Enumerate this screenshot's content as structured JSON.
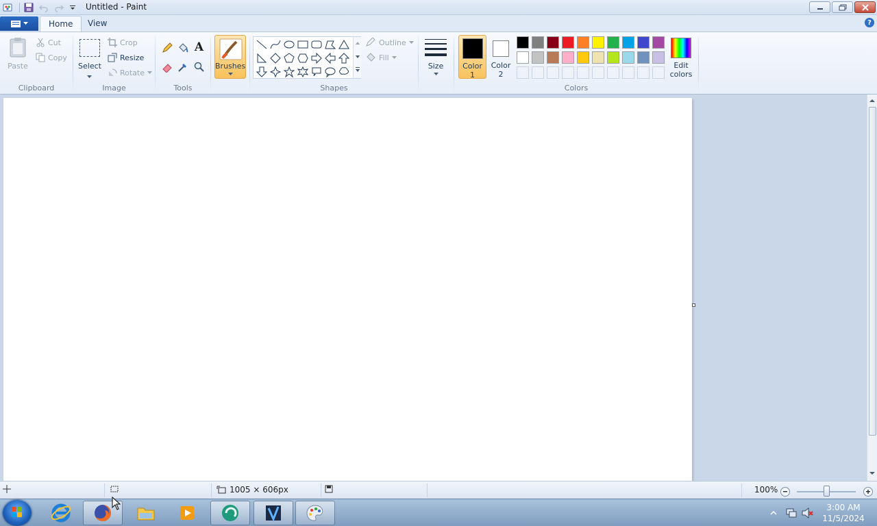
{
  "window": {
    "title": "Untitled - Paint"
  },
  "tabs": [
    {
      "label": "Home"
    },
    {
      "label": "View"
    }
  ],
  "clipboard": {
    "paste": "Paste",
    "cut": "Cut",
    "copy": "Copy",
    "label": "Clipboard"
  },
  "image": {
    "select": "Select",
    "crop": "Crop",
    "resize": "Resize",
    "rotate": "Rotate",
    "label": "Image"
  },
  "tools": {
    "label": "Tools"
  },
  "brushes": {
    "label": "Brushes"
  },
  "shapes": {
    "outline": "Outline",
    "fill": "Fill",
    "label": "Shapes"
  },
  "size": {
    "label": "Size"
  },
  "colors": {
    "color1_line1": "Color",
    "color1_line2": "1",
    "color2_line1": "Color",
    "color2_line2": "2",
    "edit_line1": "Edit",
    "edit_line2": "colors",
    "label": "Colors",
    "color1_value": "#000000",
    "color2_value": "#ffffff",
    "palette_row1": [
      "#000000",
      "#7f7f7f",
      "#880015",
      "#ed1c24",
      "#ff7f27",
      "#fff200",
      "#22b14c",
      "#00a2e8",
      "#3f48cc",
      "#a349a4"
    ],
    "palette_row2": [
      "#ffffff",
      "#c3c3c3",
      "#b97a57",
      "#ffaec9",
      "#ffc90e",
      "#efe4b0",
      "#b5e61d",
      "#99d9ea",
      "#7092be",
      "#c8bfe7"
    ]
  },
  "status": {
    "dimensions": "1005 × 606px",
    "zoom": "100%"
  },
  "taskbar": {
    "clock_time": "3:00 AM",
    "clock_date": "11/5/2024"
  }
}
